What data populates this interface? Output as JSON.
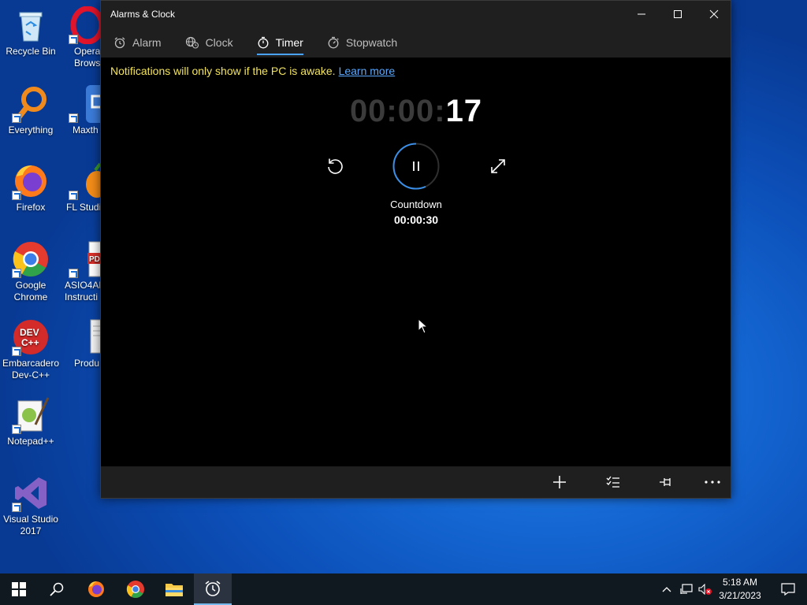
{
  "desktop": {
    "icons": [
      {
        "label": "Recycle Bin"
      },
      {
        "label": "Opera Brows"
      },
      {
        "label": "Everything"
      },
      {
        "label": "Maxth"
      },
      {
        "label": "Firefox"
      },
      {
        "label": "FL Studi"
      },
      {
        "label": "Google Chrome"
      },
      {
        "label": "ASIO4AL Instructi"
      },
      {
        "label": "Embarcadero Dev-C++"
      },
      {
        "label": "Produ"
      },
      {
        "label": "Notepad++"
      },
      {
        "label": "Visual Studio 2017"
      }
    ]
  },
  "window": {
    "title": "Alarms & Clock",
    "controls": {
      "minimize": "minimize",
      "maximize": "maximize",
      "close": "close"
    },
    "tabs": [
      {
        "label": "Alarm",
        "icon": "alarm-icon"
      },
      {
        "label": "Clock",
        "icon": "globe-clock-icon"
      },
      {
        "label": "Timer",
        "icon": "timer-icon",
        "active": true
      },
      {
        "label": "Stopwatch",
        "icon": "stopwatch-icon"
      }
    ],
    "notice": {
      "text": "Notifications will only show if the PC is awake.",
      "link": "Learn more"
    },
    "timer": {
      "display_dim": "00:00:",
      "display_bright": "17",
      "name": "Countdown",
      "duration": "00:00:30",
      "progress": 0.43
    },
    "bottom_bar": {
      "icons": [
        "add-icon",
        "select-list-icon",
        "pin-icon",
        "more-icon"
      ]
    }
  },
  "taskbar": {
    "time": "5:18 AM",
    "date": "3/21/2023"
  },
  "colors": {
    "accent": "#4aa3ff",
    "notice": "#f2e35b",
    "link": "#5aa8ff"
  }
}
